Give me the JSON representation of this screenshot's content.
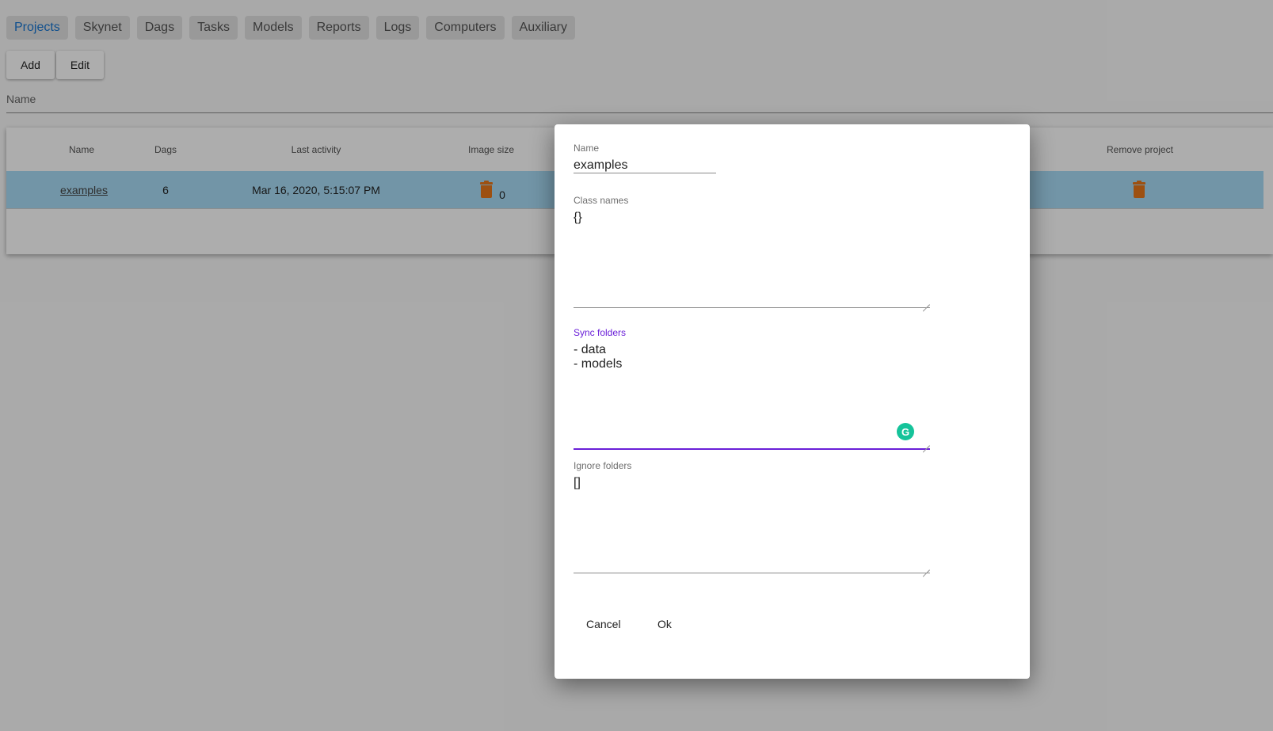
{
  "nav": {
    "tabs": [
      {
        "label": "Projects",
        "active": true
      },
      {
        "label": "Skynet"
      },
      {
        "label": "Dags"
      },
      {
        "label": "Tasks"
      },
      {
        "label": "Models"
      },
      {
        "label": "Reports"
      },
      {
        "label": "Logs"
      },
      {
        "label": "Computers"
      },
      {
        "label": "Auxiliary"
      }
    ]
  },
  "toolbar": {
    "add_label": "Add",
    "edit_label": "Edit"
  },
  "filter": {
    "name_label": "Name"
  },
  "table": {
    "headers": {
      "name": "Name",
      "dags": "Dags",
      "last_activity": "Last activity",
      "image_size": "Image size",
      "remove_project": "Remove project"
    },
    "rows": [
      {
        "name": "examples",
        "dags": "6",
        "last_activity": "Mar 16, 2020, 5:15:07 PM",
        "image_size": "0"
      }
    ]
  },
  "dialog": {
    "name": {
      "label": "Name",
      "value": "examples"
    },
    "class_names": {
      "label": "Class names",
      "value": "{}"
    },
    "sync_folders": {
      "label": "Sync folders",
      "value": "- data\n- models"
    },
    "ignore_folders": {
      "label": "Ignore folders",
      "value": "[]"
    },
    "cancel_label": "Cancel",
    "ok_label": "Ok"
  },
  "colors": {
    "accent": "#1976d2",
    "focus": "#6a1fd8",
    "selected_row": "#a8dcf6",
    "trash": "#e8771a",
    "grammarly": "#15c39a"
  },
  "icons": [
    "trash-icon",
    "grammarly-icon",
    "resize-handle-icon"
  ]
}
